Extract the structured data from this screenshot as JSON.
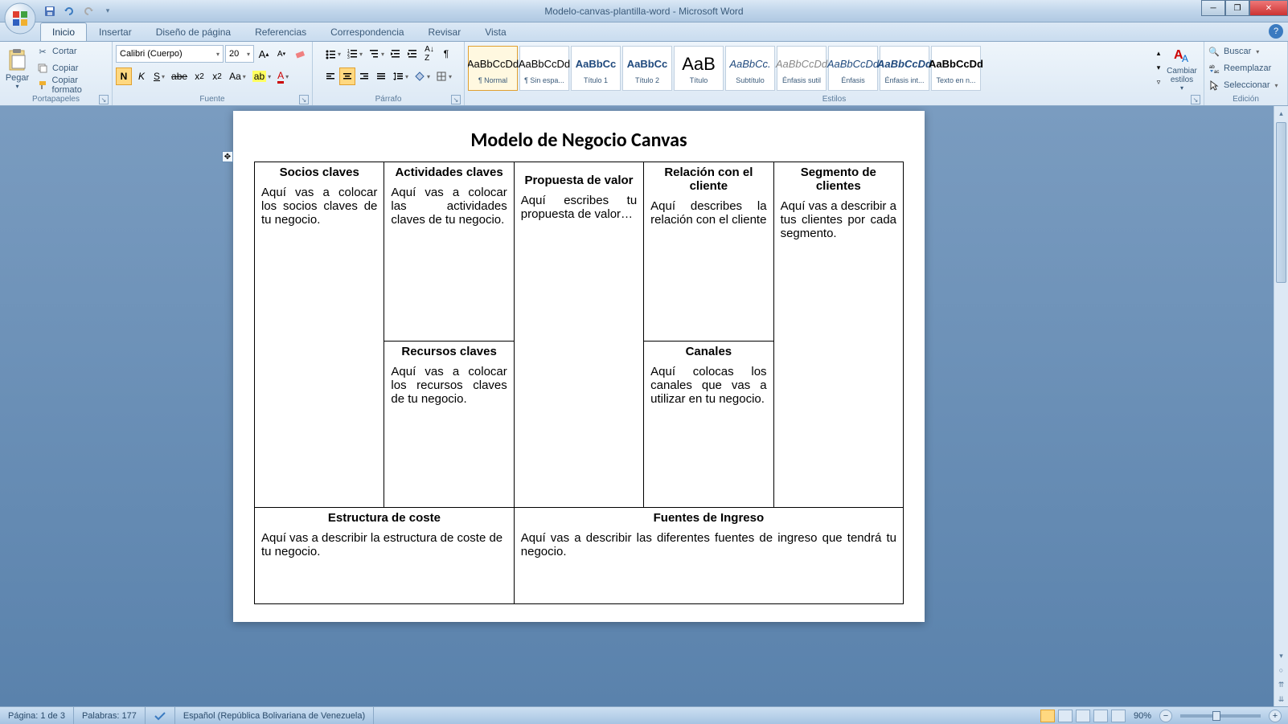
{
  "window": {
    "title": "Modelo-canvas-plantilla-word - Microsoft Word"
  },
  "tabs": {
    "inicio": "Inicio",
    "insertar": "Insertar",
    "diseno": "Diseño de página",
    "referencias": "Referencias",
    "correspondencia": "Correspondencia",
    "revisar": "Revisar",
    "vista": "Vista"
  },
  "clipboard": {
    "paste": "Pegar",
    "cut": "Cortar",
    "copy": "Copiar",
    "format": "Copiar formato",
    "label": "Portapapeles"
  },
  "font": {
    "name": "Calibri (Cuerpo)",
    "size": "20",
    "label": "Fuente"
  },
  "paragraph": {
    "label": "Párrafo"
  },
  "styles": {
    "label": "Estilos",
    "change": "Cambiar estilos",
    "items": [
      {
        "preview": "AaBbCcDd",
        "label": "¶ Normal",
        "color": "#000"
      },
      {
        "preview": "AaBbCcDd",
        "label": "¶ Sin espa...",
        "color": "#000"
      },
      {
        "preview": "AaBbCc",
        "label": "Título 1",
        "color": "#1f497d",
        "bold": true
      },
      {
        "preview": "AaBbCc",
        "label": "Título 2",
        "color": "#1f497d",
        "bold": true
      },
      {
        "preview": "AaB",
        "label": "Título",
        "color": "#000",
        "size": "22px"
      },
      {
        "preview": "AaBbCc.",
        "label": "Subtítulo",
        "color": "#1f497d",
        "italic": true
      },
      {
        "preview": "AaBbCcDd",
        "label": "Énfasis sutil",
        "color": "#888",
        "italic": true
      },
      {
        "preview": "AaBbCcDd",
        "label": "Énfasis",
        "color": "#1f497d",
        "italic": true
      },
      {
        "preview": "AaBbCcDd",
        "label": "Énfasis int...",
        "color": "#1f497d",
        "italic": true,
        "bold": true
      },
      {
        "preview": "AaBbCcDd",
        "label": "Texto en n...",
        "color": "#000",
        "bold": true
      }
    ]
  },
  "editing": {
    "find": "Buscar",
    "replace": "Reemplazar",
    "select": "Seleccionar",
    "label": "Edición"
  },
  "document": {
    "title": "Modelo de Negocio Canvas",
    "cells": {
      "socios_h": "Socios claves",
      "socios_b": "Aquí vas a colocar los socios claves de tu negocio.",
      "actividades_h": "Actividades claves",
      "actividades_b": "Aquí vas a colocar las actividades claves de tu negocio.",
      "recursos_h": "Recursos claves",
      "recursos_b": "Aquí vas a colocar los recursos claves de tu negocio.",
      "propuesta_h": "Propuesta de valor",
      "propuesta_b": "Aquí escribes tu propuesta de valor…",
      "relacion_h": "Relación con el cliente",
      "relacion_b": "Aquí describes la relación con el cliente",
      "canales_h": "Canales",
      "canales_b": "Aquí colocas los canales que vas a utilizar en tu negocio.",
      "segmento_h": "Segmento de clientes",
      "segmento_b": "Aquí vas a describir a tus clientes por cada segmento.",
      "coste_h": "Estructura de coste",
      "coste_b": "Aquí vas a describir la estructura de coste de tu negocio.",
      "ingreso_h": "Fuentes de Ingreso",
      "ingreso_b": "Aquí vas a describir las diferentes fuentes de ingreso que tendrá tu negocio."
    }
  },
  "status": {
    "page": "Página: 1 de 3",
    "words": "Palabras: 177",
    "lang": "Español (República Bolivariana de Venezuela)",
    "zoom": "90%"
  }
}
